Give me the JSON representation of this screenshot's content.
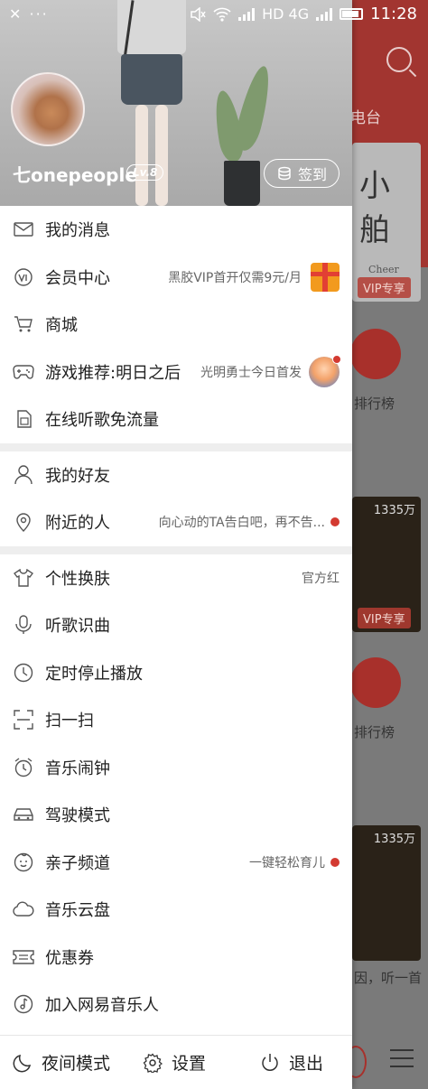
{
  "status_bar": {
    "left_icons": "✕ ···",
    "network": "HD 4G",
    "time": "11:28"
  },
  "background_app": {
    "tab_label": "电台",
    "card1_badge": "VIP专享",
    "card1_text": "Cheer",
    "card1_glyphs": "小 舶",
    "rank_label_1": "排行榜",
    "card2_count": "1335万",
    "card2_badge": "VIP专享",
    "rank_label_2": "排行榜",
    "card3_count": "1335万",
    "bottom_text": "因，听一首"
  },
  "profile": {
    "username": "七onepeople",
    "level": "Lv.8",
    "checkin_label": "签到"
  },
  "menu_group1": [
    {
      "label": "我的消息",
      "icon": "mail-icon"
    },
    {
      "label": "会员中心",
      "icon": "vip-icon",
      "extra": "黑胶VIP首开仅需9元/月"
    },
    {
      "label": "商城",
      "icon": "cart-icon"
    },
    {
      "label": "游戏推荐:明日之后",
      "icon": "gamepad-icon",
      "extra": "光明勇士今日首发"
    },
    {
      "label": "在线听歌免流量",
      "icon": "sim-card-icon"
    }
  ],
  "menu_group2": [
    {
      "label": "我的好友",
      "icon": "user-icon"
    },
    {
      "label": "附近的人",
      "icon": "location-icon",
      "extra": "向心动的TA告白吧，再不告..."
    }
  ],
  "menu_group3": [
    {
      "label": "个性换肤",
      "icon": "tshirt-icon",
      "extra": "官方红"
    },
    {
      "label": "听歌识曲",
      "icon": "microphone-icon"
    },
    {
      "label": "定时停止播放",
      "icon": "clock-icon"
    },
    {
      "label": "扫一扫",
      "icon": "scan-icon"
    },
    {
      "label": "音乐闹钟",
      "icon": "alarm-icon"
    },
    {
      "label": "驾驶模式",
      "icon": "car-icon"
    },
    {
      "label": "亲子频道",
      "icon": "baby-icon",
      "extra": "一键轻松育儿"
    },
    {
      "label": "音乐云盘",
      "icon": "cloud-icon"
    },
    {
      "label": "优惠券",
      "icon": "coupon-icon"
    },
    {
      "label": "加入网易音乐人",
      "icon": "music-note-icon"
    }
  ],
  "bottom_bar": {
    "night_mode": "夜间模式",
    "settings": "设置",
    "exit": "退出"
  },
  "colors": {
    "accent_red": "#d33a31",
    "text": "#222222",
    "secondary_text": "#666666"
  }
}
